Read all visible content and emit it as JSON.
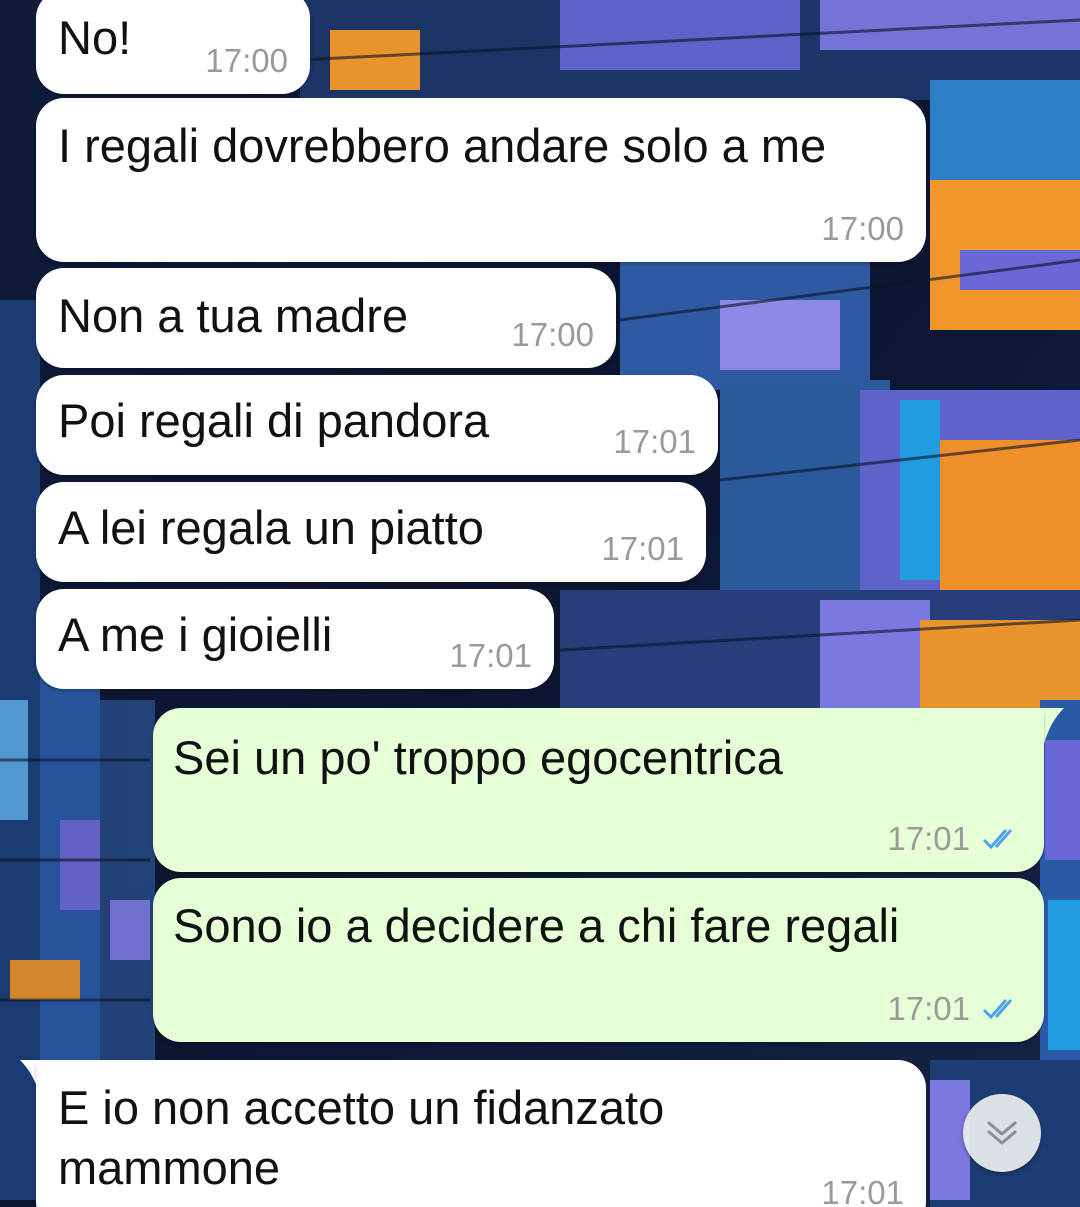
{
  "messages": [
    {
      "side": "in",
      "text": "No!",
      "time": "17:00"
    },
    {
      "side": "in",
      "text": "I regali dovrebbero andare solo a me",
      "time": "17:00"
    },
    {
      "side": "in",
      "text": "Non a tua madre",
      "time": "17:00"
    },
    {
      "side": "in",
      "text": "Poi regali di pandora",
      "time": "17:01"
    },
    {
      "side": "in",
      "text": "A lei regala un piatto",
      "time": "17:01"
    },
    {
      "side": "in",
      "text": "A me i gioielli",
      "time": "17:01"
    },
    {
      "side": "out",
      "text": "Sei un po' troppo egocentrica",
      "time": "17:01",
      "status": "read"
    },
    {
      "side": "out",
      "text": "Sono io a decidere a chi fare regali",
      "time": "17:01",
      "status": "read"
    },
    {
      "side": "in",
      "text": "E io non accetto un fidanzato mammone",
      "time": "17:01"
    }
  ],
  "colors": {
    "incoming_bubble": "#ffffff",
    "outgoing_bubble": "#e6ffd7",
    "read_ticks": "#4fa3f7",
    "timestamp": "#9a9a9a"
  },
  "icons": {
    "read_status": "double-check-icon",
    "scroll_down": "chevron-double-down-icon"
  }
}
